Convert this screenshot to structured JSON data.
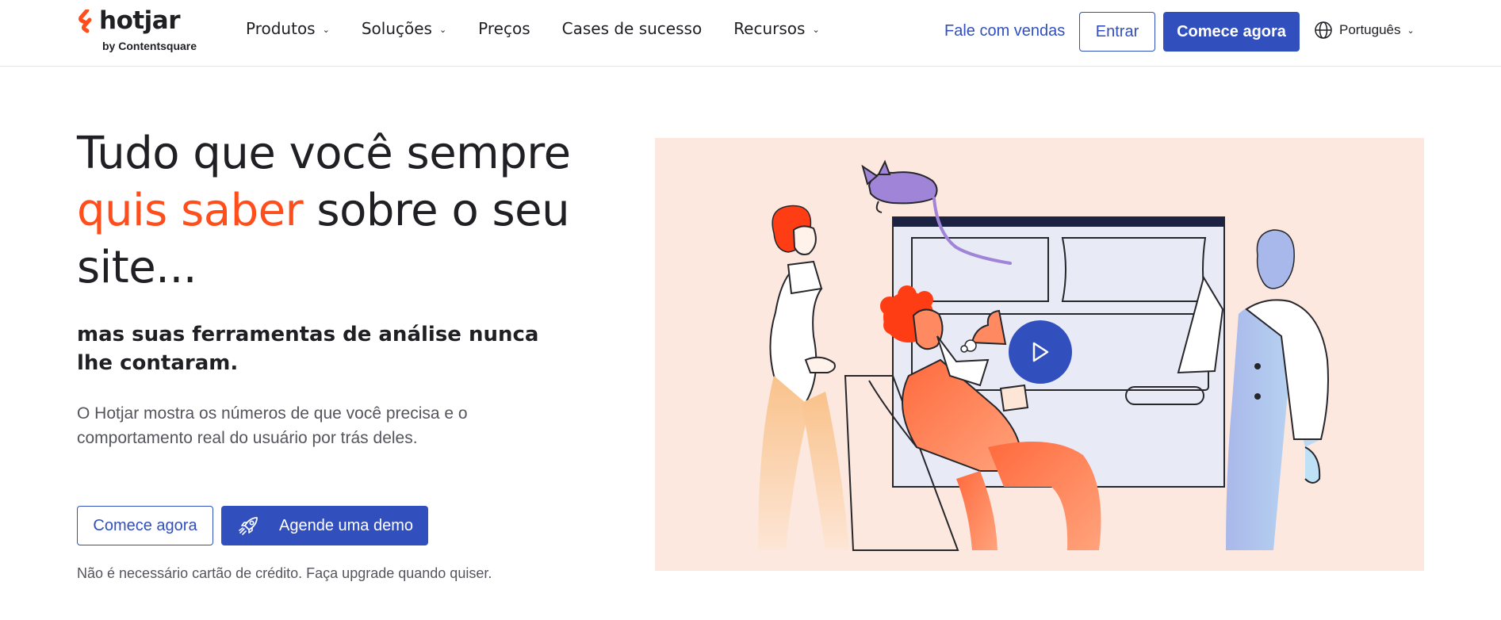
{
  "header": {
    "logo": {
      "name": "hotjar",
      "tagline": "by Contentsquare"
    },
    "nav": [
      {
        "label": "Produtos",
        "has_dropdown": true
      },
      {
        "label": "Soluções",
        "has_dropdown": true
      },
      {
        "label": "Preços",
        "has_dropdown": false
      },
      {
        "label": "Cases de sucesso",
        "has_dropdown": false
      },
      {
        "label": "Recursos",
        "has_dropdown": true
      }
    ],
    "talk_to_sales": "Fale com vendas",
    "login": "Entrar",
    "start_now": "Comece agora",
    "language": "Português"
  },
  "hero": {
    "title_before": "Tudo que você sempre",
    "title_accent": "quis saber",
    "title_after": "sobre o seu site...",
    "subtitle": "mas suas ferramentas de análise nunca lhe contaram.",
    "description": "O Hotjar mostra os números de que você precisa e o comportamento real do usuário por trás deles.",
    "cta_primary": "Comece agora",
    "cta_demo": "Agende uma demo",
    "note": "Não é necessário cartão de crédito. Faça upgrade quando quiser."
  },
  "colors": {
    "brand_blue": "#324fbe",
    "accent_orange": "#ff4e1b",
    "illustration_bg": "#fde8df"
  },
  "icons": {
    "logo": "hotjar-logo-icon",
    "globe": "globe-icon",
    "chevron": "chevron-down-icon",
    "rocket": "rocket-icon",
    "play": "play-icon"
  }
}
